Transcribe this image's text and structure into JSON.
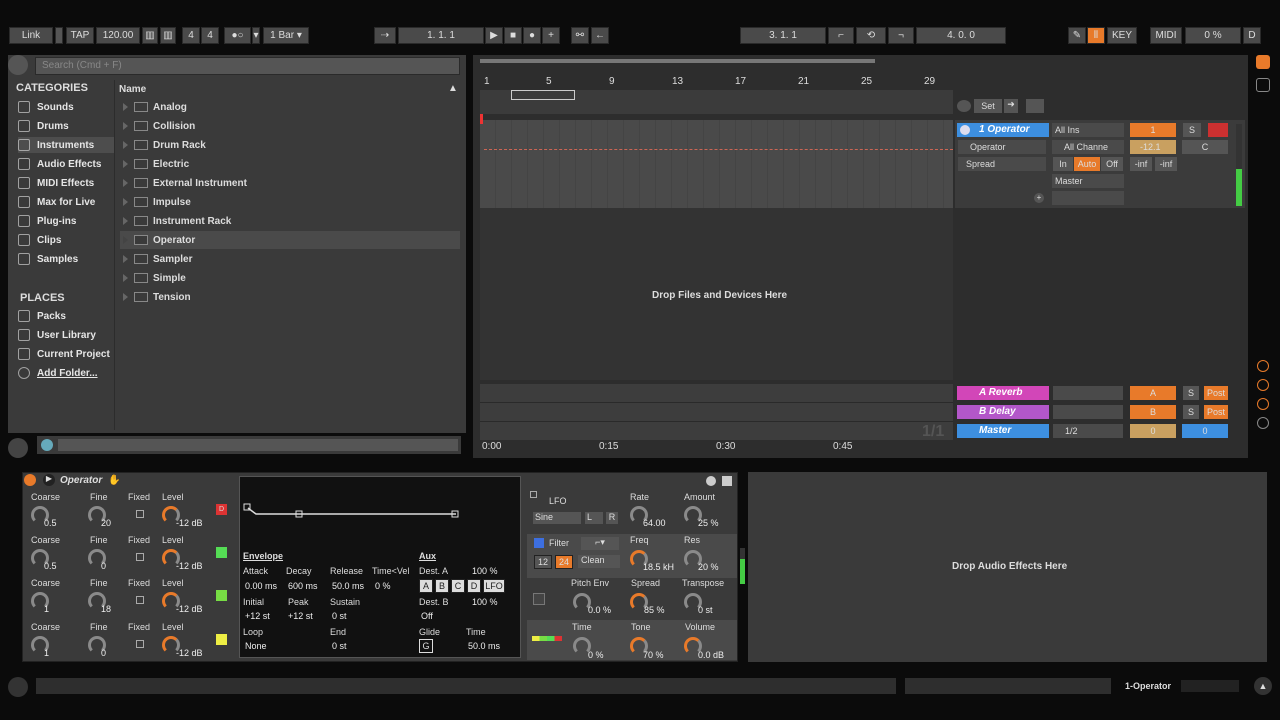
{
  "transport": {
    "link": "Link",
    "tap": "TAP",
    "tempo": "120.00",
    "meter_num": "4",
    "meter_den": "4",
    "quant": "1 Bar",
    "pos": "1.   1.   1",
    "loop_start": "3.   1.   1",
    "loop_len": "4.   0.   0",
    "key": "KEY",
    "midi": "MIDI",
    "cpu": "0 %",
    "d": "D"
  },
  "browser": {
    "search_placeholder": "Search (Cmd + F)",
    "categories_title": "CATEGORIES",
    "name_header": "Name",
    "categories": [
      "Sounds",
      "Drums",
      "Instruments",
      "Audio Effects",
      "MIDI Effects",
      "Max for Live",
      "Plug-ins",
      "Clips",
      "Samples"
    ],
    "places_title": "PLACES",
    "places": [
      "Packs",
      "User Library",
      "Current Project",
      "Add Folder..."
    ],
    "files": [
      "Analog",
      "Collision",
      "Drum Rack",
      "Electric",
      "External Instrument",
      "Impulse",
      "Instrument Rack",
      "Operator",
      "Sampler",
      "Simple",
      "Tension"
    ]
  },
  "arrangement": {
    "bars": [
      "1",
      "5",
      "9",
      "13",
      "17",
      "21",
      "25",
      "29"
    ],
    "drop_text": "Drop Files and Devices Here",
    "times": [
      "0:00",
      "0:15",
      "0:30",
      "0:45"
    ],
    "page": "1/1",
    "set": "Set"
  },
  "mixer": {
    "track1": "1 Operator",
    "ins": "All Ins",
    "device": "Operator",
    "channel": "All Channe",
    "param": "Spread",
    "in": "In",
    "auto": "Auto",
    "off": "Off",
    "out": "Master",
    "num": "1",
    "s": "S",
    "vol": "-12.1",
    "pan": "C",
    "inf1": "-inf",
    "inf2": "-inf",
    "returnA": "A Reverb",
    "returnB": "B Delay",
    "master": "Master",
    "a": "A",
    "b": "B",
    "post": "Post",
    "cue": "1/2",
    "mvol": "0",
    "mpan": "0"
  },
  "device": {
    "name": "Operator",
    "osc": [
      {
        "coarse": "0.5",
        "fine": "20",
        "level": "-12 dB",
        "tag": "D",
        "color": "#d33"
      },
      {
        "coarse": "0.5",
        "fine": "0",
        "level": "-12 dB",
        "tag": "",
        "color": "#5d5"
      },
      {
        "coarse": "1",
        "fine": "18",
        "level": "-12 dB",
        "tag": "",
        "color": "#7d4"
      },
      {
        "coarse": "1",
        "fine": "0",
        "level": "-12 dB",
        "tag": "",
        "color": "#ee4"
      }
    ],
    "labels": {
      "coarse": "Coarse",
      "fine": "Fine",
      "fixed": "Fixed",
      "level": "Level"
    },
    "env": {
      "title": "Envelope",
      "attack": "Attack",
      "decay": "Decay",
      "release": "Release",
      "timevel": "Time<Vel",
      "attack_v": "0.00 ms",
      "decay_v": "600 ms",
      "release_v": "50.0 ms",
      "timevel_v": "0 %",
      "initial": "Initial",
      "peak": "Peak",
      "sustain": "Sustain",
      "initial_v": "+12 st",
      "peak_v": "+12 st",
      "sustain_v": "0 st",
      "loop": "Loop",
      "end": "End",
      "loop_v": "None",
      "end_v": "0 st"
    },
    "aux": {
      "title": "Aux",
      "desta": "Dest. A",
      "desta_v": "100 %",
      "destb": "Dest. B",
      "destb_v": "100 %",
      "off": "Off",
      "glide": "Glide",
      "glide_v": "G",
      "time": "Time",
      "time_v": "50.0 ms",
      "buttons": [
        "A",
        "B",
        "C",
        "D",
        "LFO"
      ]
    },
    "lfo": {
      "title": "LFO",
      "rate": "Rate",
      "amount": "Amount",
      "wave": "Sine",
      "l": "L",
      "r": "R",
      "rate_v": "64.00",
      "amount_v": "25 %"
    },
    "filter": {
      "title": "Filter",
      "freq": "Freq",
      "res": "Res",
      "n12": "12",
      "n24": "24",
      "type": "Clean",
      "freq_v": "18.5 kH",
      "res_v": "20 %"
    },
    "pitch": {
      "env": "Pitch Env",
      "spread": "Spread",
      "transpose": "Transpose",
      "env_v": "0.0 %",
      "spread_v": "85 %",
      "transpose_v": "0 st"
    },
    "global": {
      "time": "Time",
      "tone": "Tone",
      "volume": "Volume",
      "time_v": "0 %",
      "tone_v": "70 %",
      "volume_v": "0.0 dB"
    }
  },
  "fx_drop": "Drop Audio Effects Here",
  "status": {
    "track": "1-Operator"
  }
}
